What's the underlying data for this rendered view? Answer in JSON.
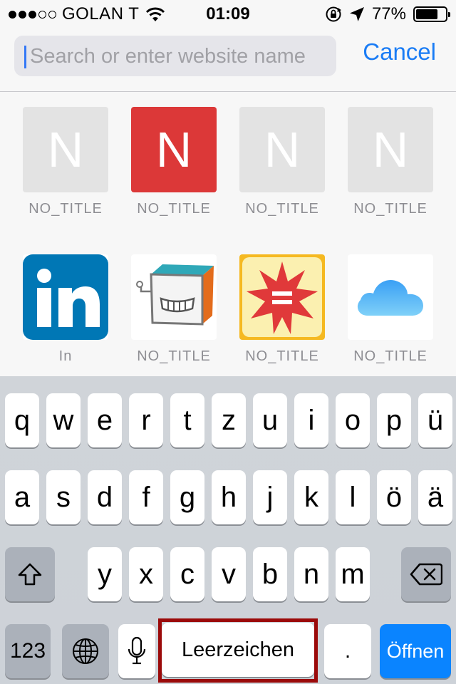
{
  "status_bar": {
    "carrier": "GOLAN T",
    "time": "01:09",
    "battery_percent": "77%",
    "battery_level": 0.77,
    "signal_bars": 3,
    "signal_total": 5
  },
  "search": {
    "placeholder": "Search or enter website name",
    "value": "",
    "cancel_label": "Cancel"
  },
  "favorites": [
    {
      "letter": "N",
      "label": "NO_TITLE",
      "style": "gray"
    },
    {
      "letter": "N",
      "label": "NO_TITLE",
      "style": "red",
      "color": "#dc3838"
    },
    {
      "letter": "N",
      "label": "NO_TITLE",
      "style": "gray"
    },
    {
      "letter": "N",
      "label": "NO_TITLE",
      "style": "gray"
    },
    {
      "label": "In",
      "icon": "linkedin-icon",
      "color": "#0077b5"
    },
    {
      "label": "NO_TITLE",
      "icon": "box-robot-icon"
    },
    {
      "label": "NO_TITLE",
      "icon": "red-star-equals-icon"
    },
    {
      "label": "NO_TITLE",
      "icon": "icloud-icon"
    }
  ],
  "keyboard": {
    "row1": [
      "q",
      "w",
      "e",
      "r",
      "t",
      "z",
      "u",
      "i",
      "o",
      "p",
      "ü"
    ],
    "row2": [
      "a",
      "s",
      "d",
      "f",
      "g",
      "h",
      "j",
      "k",
      "l",
      "ö",
      "ä"
    ],
    "row3": [
      "y",
      "x",
      "c",
      "v",
      "b",
      "n",
      "m"
    ],
    "numbers_label": "123",
    "space_label": "Leerzeichen",
    "period_label": ".",
    "return_label": "Öffnen",
    "accent_color": "#0a84ff"
  }
}
